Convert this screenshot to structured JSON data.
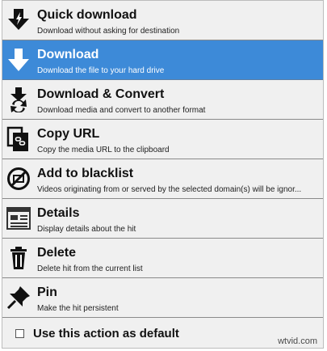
{
  "menu": {
    "items": [
      {
        "title": "Quick download",
        "desc": "Download without asking for destination",
        "icon": "quick-download-icon"
      },
      {
        "title": "Download",
        "desc": "Download the file to your hard drive",
        "icon": "download-arrow-icon",
        "selected": true
      },
      {
        "title": "Download & Convert",
        "desc": "Download media and convert to another format",
        "icon": "download-convert-icon"
      },
      {
        "title": "Copy URL",
        "desc": "Copy the media URL to the clipboard",
        "icon": "copy-url-icon"
      },
      {
        "title": "Add to blacklist",
        "desc": "Videos originating from or served by the selected domain(s) will be ignor...",
        "icon": "blacklist-icon"
      },
      {
        "title": "Details",
        "desc": "Display details about the hit",
        "icon": "details-icon"
      },
      {
        "title": "Delete",
        "desc": "Delete hit from the current list",
        "icon": "trash-icon"
      },
      {
        "title": "Pin",
        "desc": "Make the hit persistent",
        "icon": "pin-icon"
      }
    ],
    "default_checkbox_label": "Use this action as default",
    "default_checked": false
  },
  "watermark": "wtvid.com",
  "colors": {
    "selected_bg": "#3d8ad8",
    "menu_bg": "#f0f0f0",
    "separator": "#8a8a8a"
  }
}
